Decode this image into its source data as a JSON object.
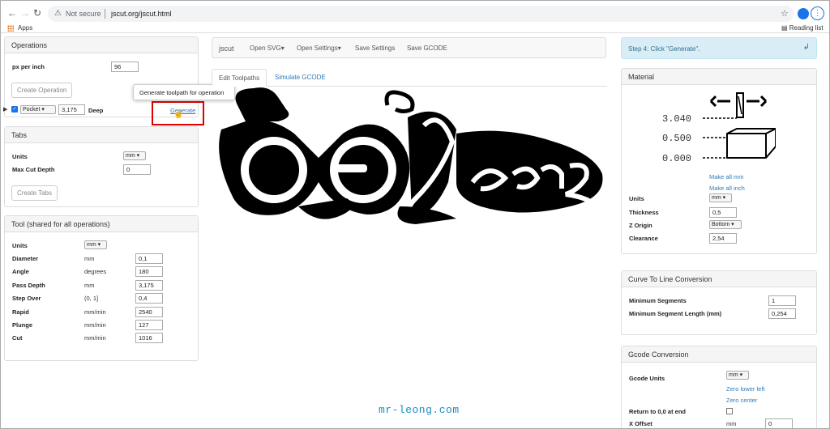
{
  "browser": {
    "not_secure": "Not secure",
    "url": "jscut.org/jscut.html",
    "apps": "Apps",
    "reading_list": "Reading list"
  },
  "operations": {
    "title": "Operations",
    "px_per_inch_label": "px per inch",
    "px_per_inch": "96",
    "create_btn": "Create Operation",
    "op": {
      "type": "Pocket",
      "depth": "3,175",
      "deep_label": "Deep",
      "generate": "Generate"
    },
    "tooltip": "Generate toolpath for operation"
  },
  "tabs_panel": {
    "title": "Tabs",
    "units_label": "Units",
    "units": "mm",
    "max_cut_label": "Max Cut Depth",
    "max_cut": "0",
    "create_btn": "Create Tabs"
  },
  "tool": {
    "title": "Tool (shared for all operations)",
    "units_label": "Units",
    "units": "mm",
    "rows": [
      {
        "label": "Diameter",
        "unit": "mm",
        "value": "0,1"
      },
      {
        "label": "Angle",
        "unit": "degrees",
        "value": "180"
      },
      {
        "label": "Pass Depth",
        "unit": "mm",
        "value": "3,175"
      },
      {
        "label": "Step Over",
        "unit": "(0, 1]",
        "value": "0,4"
      },
      {
        "label": "Rapid",
        "unit": "mm/min",
        "value": "2540"
      },
      {
        "label": "Plunge",
        "unit": "mm/min",
        "value": "127"
      },
      {
        "label": "Cut",
        "unit": "mm/min",
        "value": "1016"
      }
    ]
  },
  "nav": {
    "brand": "jscut",
    "open_svg": "Open SVG▾",
    "open_settings": "Open Settings▾",
    "save_settings": "Save Settings",
    "save_gcode": "Save GCODE"
  },
  "main_tabs": {
    "edit": "Edit Toolpaths",
    "simulate": "Simulate GCODE"
  },
  "step": "Step 4: Click \"Generate\".",
  "material": {
    "title": "Material",
    "v1": "3.040",
    "v2": "0.500",
    "v3": "0.000",
    "make_mm": "Make all mm",
    "make_inch": "Make all inch",
    "units_label": "Units",
    "units": "mm",
    "thickness_label": "Thickness",
    "thickness": "0,5",
    "zorigin_label": "Z Origin",
    "zorigin": "Bottom",
    "clearance_label": "Clearance",
    "clearance": "2,54"
  },
  "curve": {
    "title": "Curve To Line Conversion",
    "min_seg_label": "Minimum Segments",
    "min_seg": "1",
    "min_len_label": "Minimum Segment Length (mm)",
    "min_len": "0,254"
  },
  "gcode": {
    "title": "Gcode Conversion",
    "units_label": "Gcode Units",
    "units": "mm",
    "zero_ll": "Zero lower left",
    "zero_c": "Zero center",
    "return_label": "Return to 0,0 at end",
    "xoff_label": "X Offset",
    "xoff_unit": "mm",
    "xoff": "0"
  },
  "watermark": "mr-leong.com"
}
